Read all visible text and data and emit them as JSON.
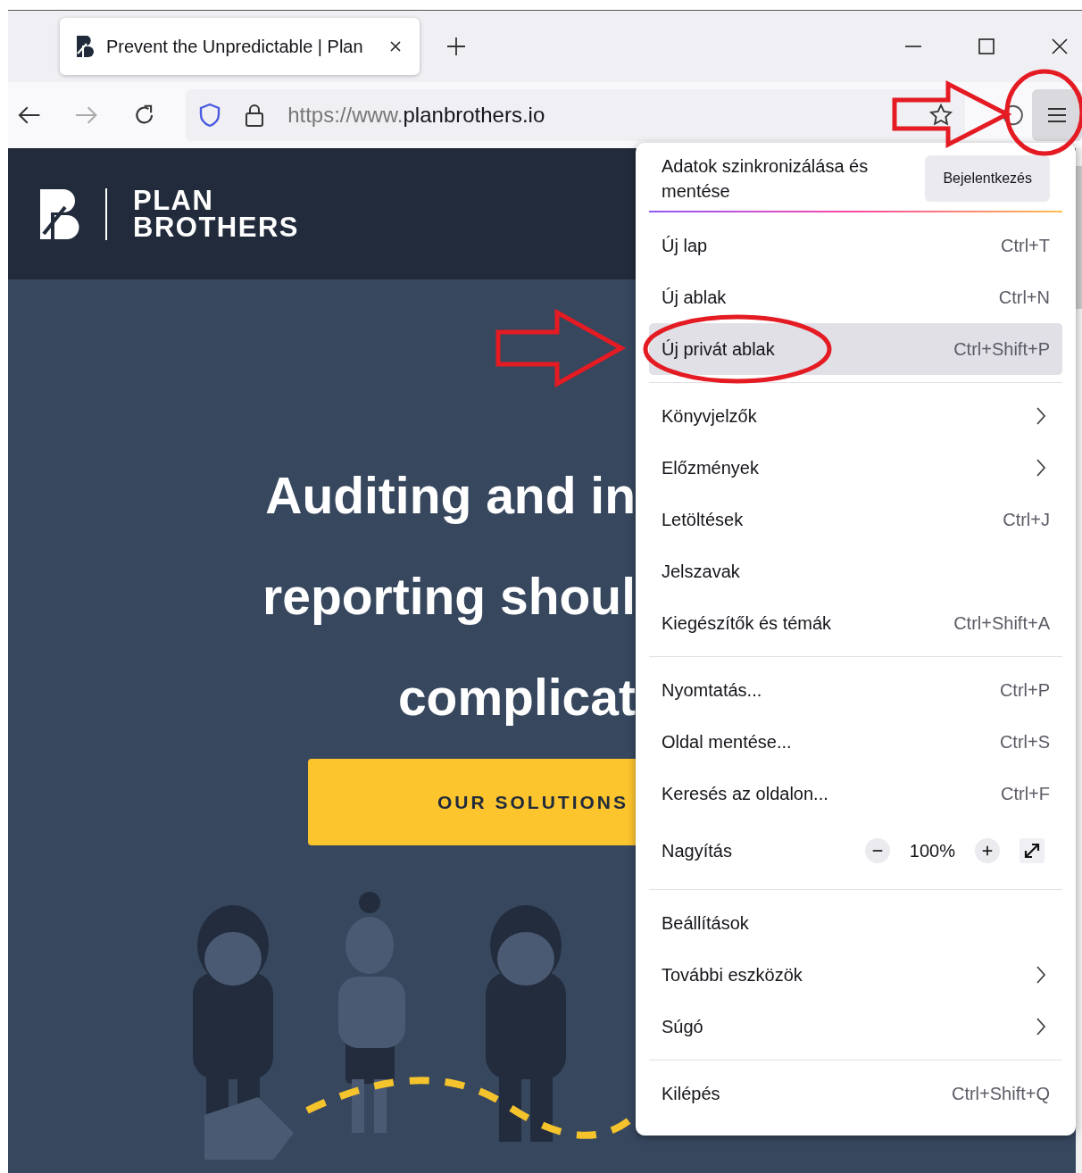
{
  "browser": {
    "tab": {
      "title": "Prevent the Unpredictable | Plan"
    },
    "url": {
      "prefix": "https://www.",
      "domain": "planbrothers.io"
    }
  },
  "page": {
    "logo": {
      "line_1": "PLAN",
      "line_2": "BROTHERS"
    },
    "headline": [
      "Auditing and in",
      "reporting shoul",
      "complicat"
    ],
    "cta": "OUR SOLUTIONS"
  },
  "menu": {
    "sync": {
      "text": "Adatok szinkronizálása és mentése",
      "button": "Bejelentkezés"
    },
    "sections": [
      [
        {
          "kind": "item",
          "label": "Új lap",
          "shortcut": "Ctrl+T",
          "selected": false
        },
        {
          "kind": "item",
          "label": "Új ablak",
          "shortcut": "Ctrl+N",
          "selected": false
        },
        {
          "kind": "item",
          "label": "Új privát ablak",
          "shortcut": "Ctrl+Shift+P",
          "selected": true
        }
      ],
      [
        {
          "kind": "submenu",
          "label": "Könyvjelzők",
          "selected": false
        },
        {
          "kind": "submenu",
          "label": "Előzmények",
          "selected": false
        },
        {
          "kind": "item",
          "label": "Letöltések",
          "shortcut": "Ctrl+J",
          "selected": false
        },
        {
          "kind": "item",
          "label": "Jelszavak",
          "selected": false
        },
        {
          "kind": "item",
          "label": "Kiegészítők és témák",
          "shortcut": "Ctrl+Shift+A",
          "selected": false
        }
      ],
      [
        {
          "kind": "item",
          "label": "Nyomtatás...",
          "shortcut": "Ctrl+P",
          "selected": false
        },
        {
          "kind": "item",
          "label": "Oldal mentése...",
          "shortcut": "Ctrl+S",
          "selected": false
        },
        {
          "kind": "item",
          "label": "Keresés az oldalon...",
          "shortcut": "Ctrl+F",
          "selected": false
        },
        {
          "kind": "zoom",
          "label": "Nagyítás",
          "value": "100%"
        }
      ],
      [
        {
          "kind": "item",
          "label": "Beállítások",
          "selected": false
        },
        {
          "kind": "submenu",
          "label": "További eszközök",
          "selected": false
        },
        {
          "kind": "submenu",
          "label": "Súgó",
          "selected": false
        }
      ],
      [
        {
          "kind": "item",
          "label": "Kilépés",
          "shortcut": "Ctrl+Shift+Q",
          "selected": false
        }
      ]
    ]
  }
}
